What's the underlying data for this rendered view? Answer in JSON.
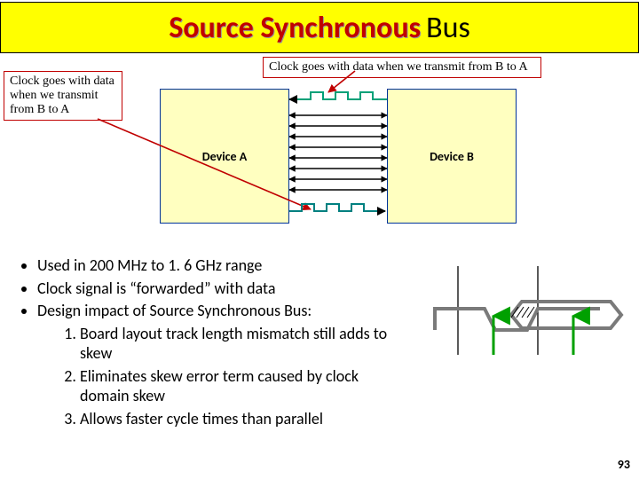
{
  "title": {
    "emph": "Source Synchronous",
    "rest": "Bus"
  },
  "callouts": {
    "left": "Clock goes with data when we transmit from B to A",
    "top": "Clock goes with data when we transmit from B to A"
  },
  "devices": {
    "a": "Device A",
    "b": "Device B"
  },
  "bullets": {
    "b1": "Used in 200 MHz to 1. 6 GHz range",
    "b2": "Clock signal is “forwarded” with data",
    "b3": "Design impact of Source Synchronous Bus:",
    "n1": "Board layout track length mismatch still adds to skew",
    "n2": "Eliminates skew error term caused by clock domain skew",
    "n3": "Allows faster cycle times than parallel"
  },
  "pagenum": "93",
  "colors": {
    "title_bg": "#ffff00",
    "emph": "#c00000",
    "device_fill": "#ffffc0",
    "device_border": "#003399",
    "clk_b2a": "#00a078",
    "clk_a2b": "#008080",
    "arrow_red": "#c00000",
    "arrow_green": "#00a000",
    "timing_grey": "#7a7a7a"
  }
}
